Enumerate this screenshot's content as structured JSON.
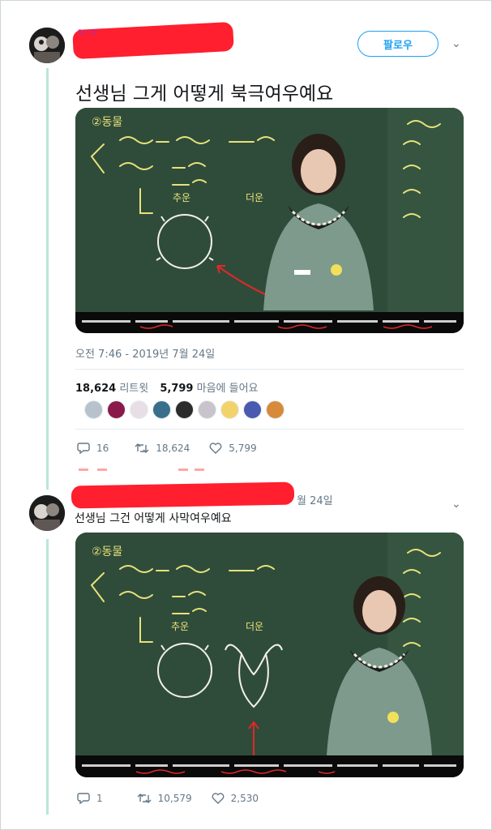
{
  "tweet1": {
    "text": "선생님 그게 어떻게 북극여우예요",
    "follow_label": "팔로우",
    "hearts": "❤❤",
    "timestamp": "오전 7:46 - 2019년 7월 24일",
    "retweets_count": "18,624",
    "retweets_label": "리트윗",
    "likes_count": "5,799",
    "likes_label": "마음에 들어요",
    "reply_count": "16",
    "retweet_action_count": "18,624",
    "like_action_count": "5,799"
  },
  "tweet2": {
    "text": "선생님 그건 어떻게 사막여우예요",
    "date_fragment": "월 24일",
    "reply_count": "1",
    "retweet_action_count": "10,579",
    "like_action_count": "2,530"
  },
  "likers": [
    {
      "name": "liker-1",
      "color": "#b7c2cc"
    },
    {
      "name": "liker-2",
      "color": "#8b1a4a"
    },
    {
      "name": "liker-3",
      "color": "#e8dfe6"
    },
    {
      "name": "liker-4",
      "color": "#3a6f8c"
    },
    {
      "name": "liker-5",
      "color": "#2c2c2c"
    },
    {
      "name": "liker-6",
      "color": "#c9c3cc"
    },
    {
      "name": "liker-7",
      "color": "#f2d36b"
    },
    {
      "name": "liker-8",
      "color": "#4a5ab0"
    },
    {
      "name": "liker-9",
      "color": "#d68a3a"
    }
  ],
  "colors": {
    "accent": "#1da1f2",
    "redaction": "#ff1f2e",
    "thread_line": "#b9e7da",
    "chalkboard": "#2f4c3a"
  }
}
